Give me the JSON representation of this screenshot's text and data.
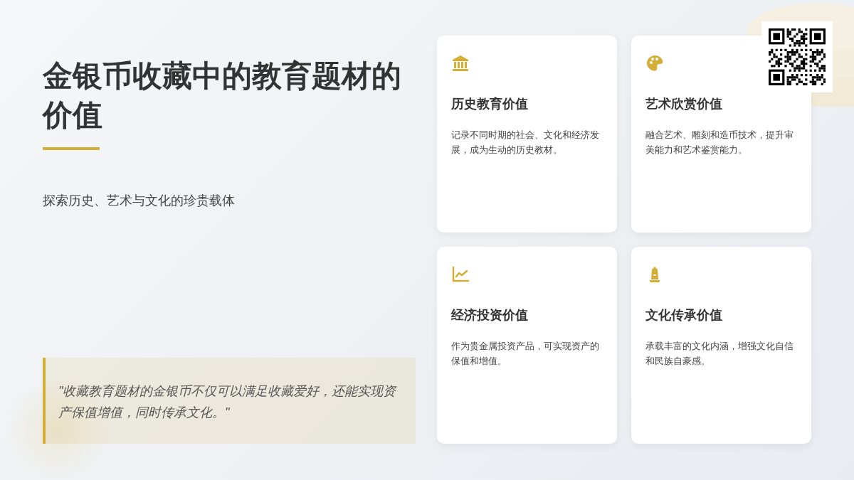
{
  "title": "金银币收藏中的教育题材的价值",
  "subtitle": "探索历史、艺术与文化的珍贵载体",
  "quote": "\"收藏教育题材的金银币不仅可以满足收藏爱好，还能实现资产保值增值，同时传承文化。\"",
  "cards": [
    {
      "kind": "museum",
      "title": "历史教育价值",
      "text": "记录不同时期的社会、文化和经济发展，成为生动的历史教材。"
    },
    {
      "kind": "palette",
      "title": "艺术欣赏价值",
      "text": "融合艺术、雕刻和造币技术，提升审美能力和艺术鉴赏能力。"
    },
    {
      "kind": "chart",
      "title": "经济投资价值",
      "text": "作为贵金属投资产品，可实现资产的保值和增值。"
    },
    {
      "kind": "monument",
      "title": "文化传承价值",
      "text": "承载丰富的文化内涵，增强文化自信和民族自豪感。"
    }
  ]
}
